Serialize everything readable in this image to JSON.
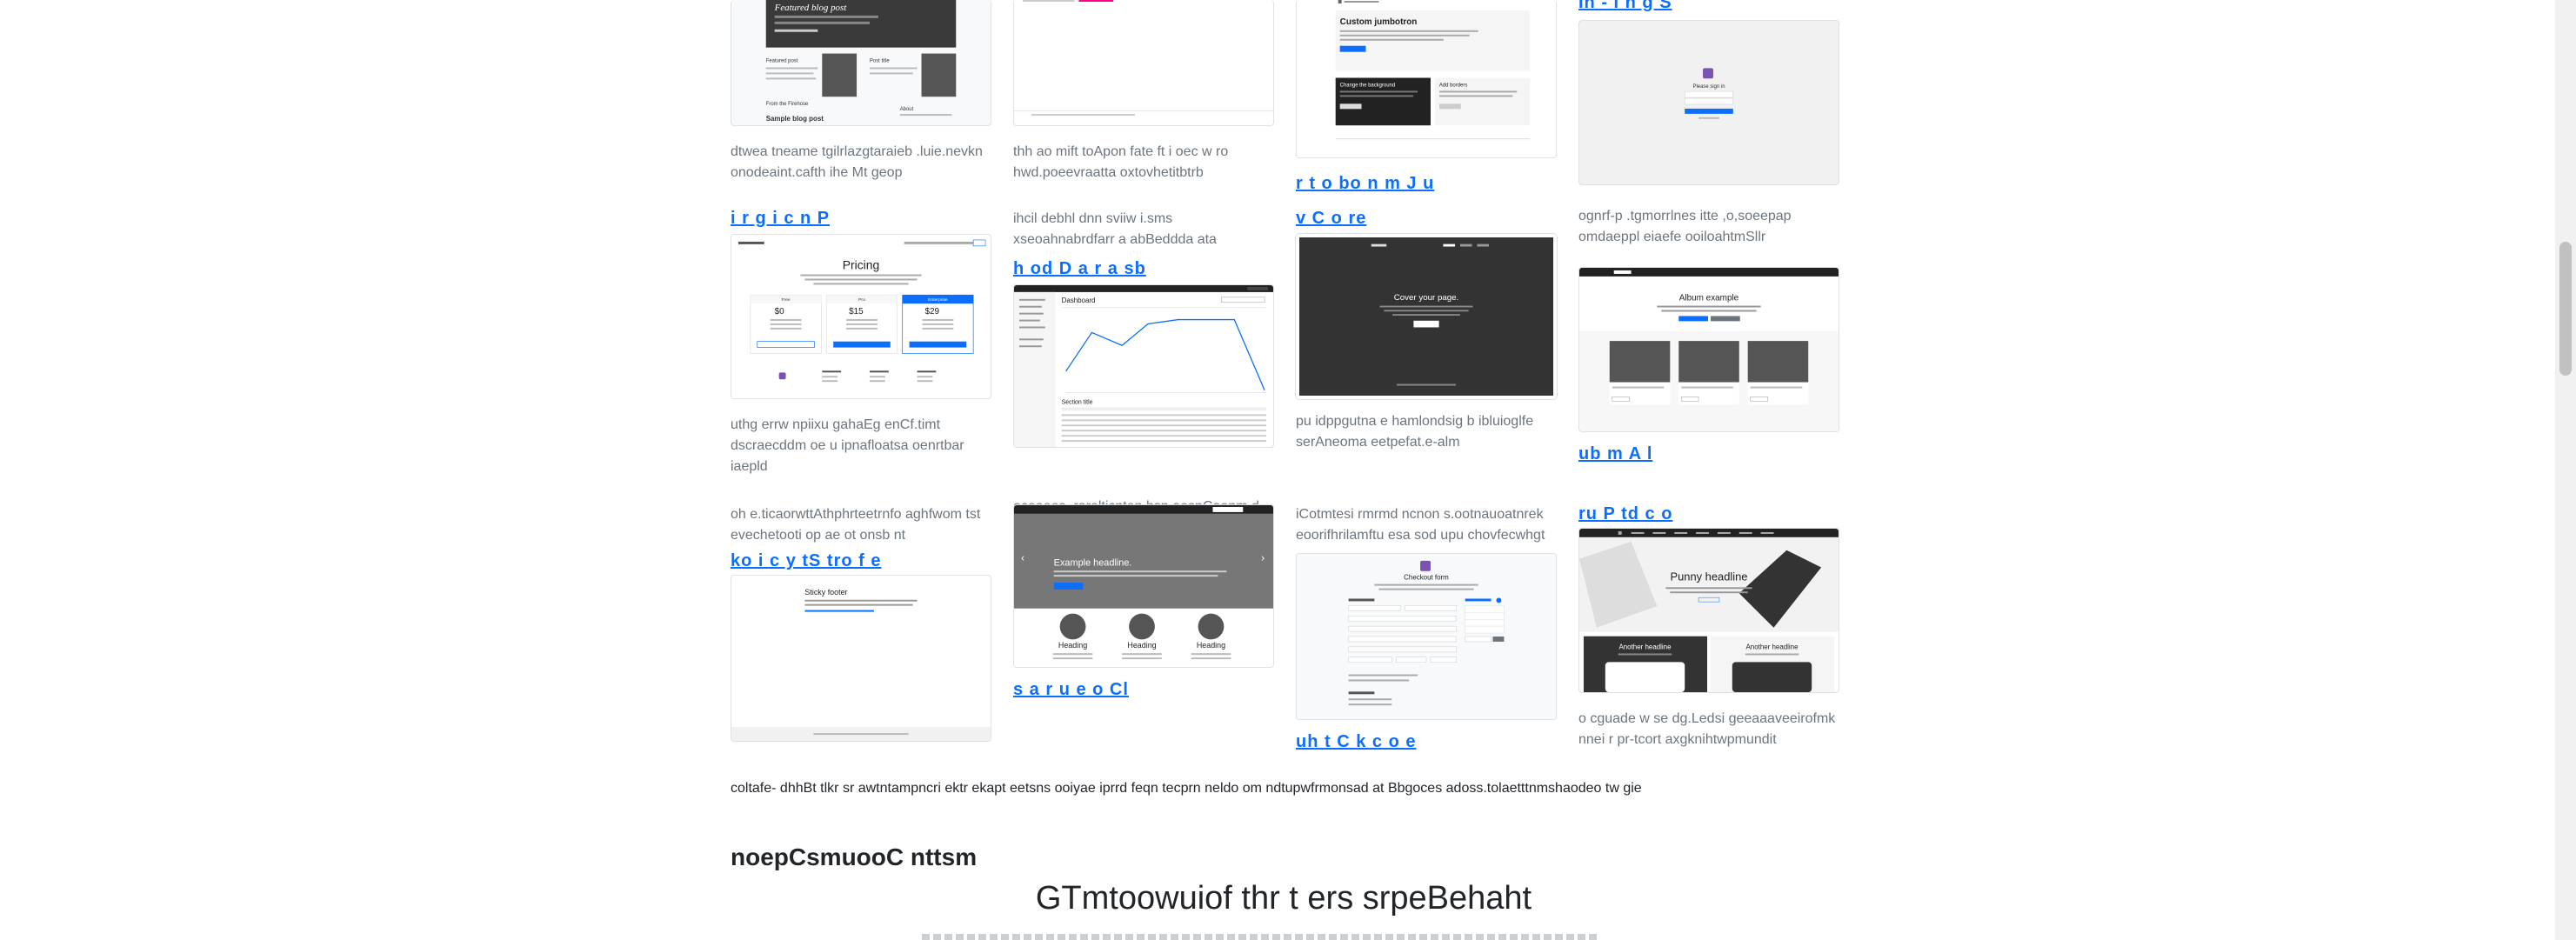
{
  "cards": [
    {
      "id": "blog",
      "title": "",
      "desc": "dtwea tneame tgilrlazgtaraieb .luie.nevkn onodeaint.cafth ihe Mt geop",
      "thumb": {
        "heading": "Featured blog post",
        "labels": [
          "Featured post",
          "Post title",
          "From the Firehose",
          "Sample blog post",
          "About"
        ]
      }
    },
    {
      "id": "t2",
      "title": "",
      "desc": "thh ao mift toApon fate ft i oec w ro hwd.poeevraatta oxtovhetitbtrb",
      "thumb": {}
    },
    {
      "id": "jumbo",
      "title": "r t o bo n m J u",
      "desc": "",
      "thumb": {
        "heading": "Custom jumbotron",
        "labels": [
          "Change the background",
          "Add borders"
        ]
      }
    },
    {
      "id": "signin",
      "title": "In - I h g S",
      "desc": "ognrf-p .tgmorrlnes itte ,o,soeepap omdaeppl eiaefe ooiloahtmSllr",
      "thumb": {
        "heading": "Please sign in"
      }
    },
    {
      "id": "pricing",
      "title": "i r g i c n P",
      "desc": "uthg errw npiixu gahaEg enCf.timt dscraecddm oe u ipnafloatsa oenrtbar iaepld",
      "thumb": {
        "heading": "Pricing",
        "prices": [
          "$0",
          "$15",
          "$29"
        ],
        "plans": [
          "Free",
          "Pro",
          "Enterprise"
        ]
      }
    },
    {
      "id": "dash",
      "title": "h od D a r a sb",
      "desc": "oceaees. roralticnten,hsn aespCaenm d uamthvnde wouzosnombtd",
      "pre": "ihcil debhl dnn sviiw i.sms xseoahnabrdfarr a abBeddda ata",
      "thumb": {
        "heading": "Dashboard",
        "section": "Section title"
      }
    },
    {
      "id": "cover",
      "title": "v C o re",
      "desc": "pu idppgutna e hamlondsig b ibluioglfe serAneoma eetpefat.e-alm",
      "thumb": {
        "heading": "Cover your page."
      }
    },
    {
      "id": "album",
      "title": "ub m A l",
      "desc": "",
      "thumb": {
        "heading": "Album example"
      }
    },
    {
      "id": "sticky",
      "title": "ko i c y tS tro f e",
      "pre": "oh e.ticaorwttAthphrteetrnfo aghfwom tst evechetooti op ae ot onsb nt",
      "desc": "",
      "thumb": {
        "heading": "Sticky footer"
      }
    },
    {
      "id": "carousel",
      "title": "s a r u e o Cl",
      "desc": "",
      "thumb": {
        "heading": "Example headline.",
        "labels": [
          "Heading",
          "Heading",
          "Heading"
        ]
      }
    },
    {
      "id": "checkout",
      "title": "uh t C k c o e",
      "pre": "iCotmtesi rmrmd ncnon s.ootnauoatnrek eoorifhrilamftu esa sod upu chovfecwhgt",
      "desc": "",
      "thumb": {
        "heading": "Checkout form"
      }
    },
    {
      "id": "product",
      "title": "ru P td c o",
      "desc": "o cguade w se dg.Ledsi geeaaaveeirofmk nnei r pr-tcort axgknihtwpmundit",
      "thumb": {
        "heading": "Punny headline",
        "labels": [
          "Another headline",
          "Another headline"
        ]
      }
    }
  ],
  "footer_text": "coltafe- dhhBt tlkr sr awtntampncri ektr ekapt eetsns ooiyae iprrd feqn tecprn neldo om ndtupwfrmonsad at Bbgoces adoss.tolaetttnmshaodeo tw gie",
  "section_title": "noepCsmuooC nttsm",
  "big_heading": "GTmtoowuiof thr t ers srpeBehaht"
}
